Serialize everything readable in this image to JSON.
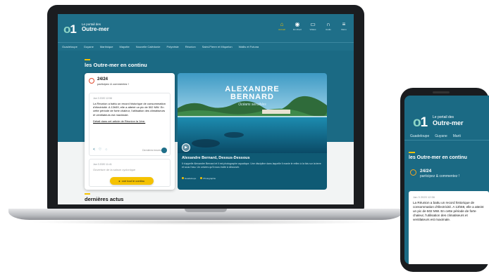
{
  "site": {
    "logo_mark": "1",
    "logo_small": "Le portail des",
    "logo_big": "Outre-mer"
  },
  "header_icons": [
    {
      "icon": "home-icon",
      "label": "Accueil",
      "active": true
    },
    {
      "icon": "radio-icon",
      "label": "En direct",
      "active": false
    },
    {
      "icon": "tv-icon",
      "label": "Vidéos",
      "active": false
    },
    {
      "icon": "headphones-icon",
      "label": "Audio",
      "active": false
    },
    {
      "icon": "menu-icon",
      "label": "Menu",
      "active": false
    }
  ],
  "nav": [
    "Guadeloupe",
    "Guyane",
    "Martinique",
    "Mayotte",
    "Nouvelle Calédonie",
    "Polynésie",
    "Réunion",
    "Saint-Pierre et Miquelon",
    "Wallis et Futuna"
  ],
  "live": {
    "section_title": "les Outre-mer en continu",
    "badge": "24/24",
    "subtitle": "participez & commentez !",
    "post_date": "Jan 3 2020 12:56",
    "post_text": "La Réunion a battu un record historique de consommation d'électricité. A 13h59, elle a atteint un pic de 502 MW. En cette période de forte chaleur, l'utilisation des climatiseurs et ventilateurs est maximale.",
    "post_link": "Détail dans cet article de Réunion la 1ère.",
    "share_icons": [
      "share-icon",
      "heart-icon",
      "comment-icon"
    ],
    "more_text": "Dernières heures",
    "second_post_date": "Jan 3 2020 11:41",
    "second_post_text": "Ouverture de la saison cyclonique",
    "see_all": "voir tout le continu"
  },
  "video": {
    "title_line1": "ALEXANDRE",
    "title_line2": "BERNARD",
    "subtitle": "Océans sensibles",
    "caption": "Alexandre Bernard, Dessus-Dessous",
    "description": "Il s'appelle Alexandre Bernard et il est photographe aquatique. Une discipline dans laquelle il manie le reflex à la fois sur la terre et sous l'eau. Un univers qu'il nous invite à découvrir.",
    "tags": [
      "Guadeloupe",
      "Photographie"
    ]
  },
  "latest": {
    "title": "dernières actus"
  },
  "phone": {
    "nav": [
      "Guadeloupe",
      "Guyane",
      "Marti"
    ]
  }
}
